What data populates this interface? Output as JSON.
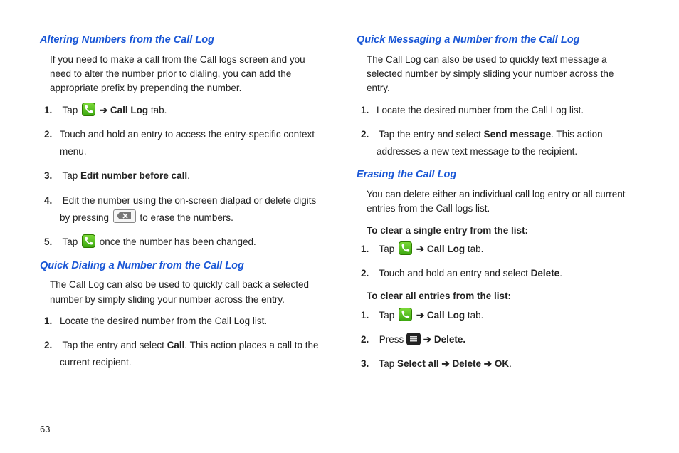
{
  "page_number": "63",
  "arrow": "➔",
  "left": {
    "h1": "Altering Numbers from the Call Log",
    "p1": "If you need to make a call from the Call logs screen and you need to alter the number prior to dialing, you can add the appropriate prefix by prepending the number.",
    "s1": {
      "a": "Tap ",
      "b": " ",
      "c": "Call Log",
      "d": " tab."
    },
    "s2": "Touch and hold an entry to access the entry-specific context menu.",
    "s3": {
      "a": "Tap ",
      "b": "Edit number before call",
      "c": "."
    },
    "s4": {
      "a": "Edit the number using the on-screen dialpad or delete digits by pressing ",
      "b": " to erase the numbers."
    },
    "s5": {
      "a": "Tap ",
      "b": " once the number has been changed."
    },
    "h2": "Quick Dialing a Number from the Call Log",
    "p2": "The Call Log can also be used to quickly call back a selected number by simply sliding your number across the entry.",
    "q1": "Locate the desired number from the Call Log list.",
    "q2": {
      "a": "Tap the entry and select ",
      "b": "Call",
      "c": ". This action places a call to the current recipient."
    }
  },
  "right": {
    "h1": "Quick Messaging a Number from the Call Log",
    "p1": "The Call Log can also be used to quickly text message a selected number by simply sliding your number across the entry.",
    "m1": "Locate the desired number from the Call Log list.",
    "m2": {
      "a": "Tap the entry and select ",
      "b": "Send message",
      "c": ". This action addresses a new text message to the recipient."
    },
    "h2": "Erasing the Call Log",
    "p2": "You can delete either an individual call log entry or all current entries from the Call logs list.",
    "bp1": "To clear a single entry from the list:",
    "e1": {
      "a": "Tap ",
      "b": " ",
      "c": "Call Log",
      "d": " tab."
    },
    "e2": {
      "a": "Touch and hold an entry and select ",
      "b": "Delete",
      "c": "."
    },
    "bp2": "To clear all entries from the list:",
    "f1": {
      "a": "Tap ",
      "b": " ",
      "c": "Call Log",
      "d": " tab."
    },
    "f2": {
      "a": "Press ",
      "b": " ",
      "c": "Delete."
    },
    "f3": {
      "a": "Tap ",
      "b": "Select all",
      "c": " ",
      "d": "Delete",
      "e": " ",
      "f": "OK",
      "g": "."
    }
  }
}
